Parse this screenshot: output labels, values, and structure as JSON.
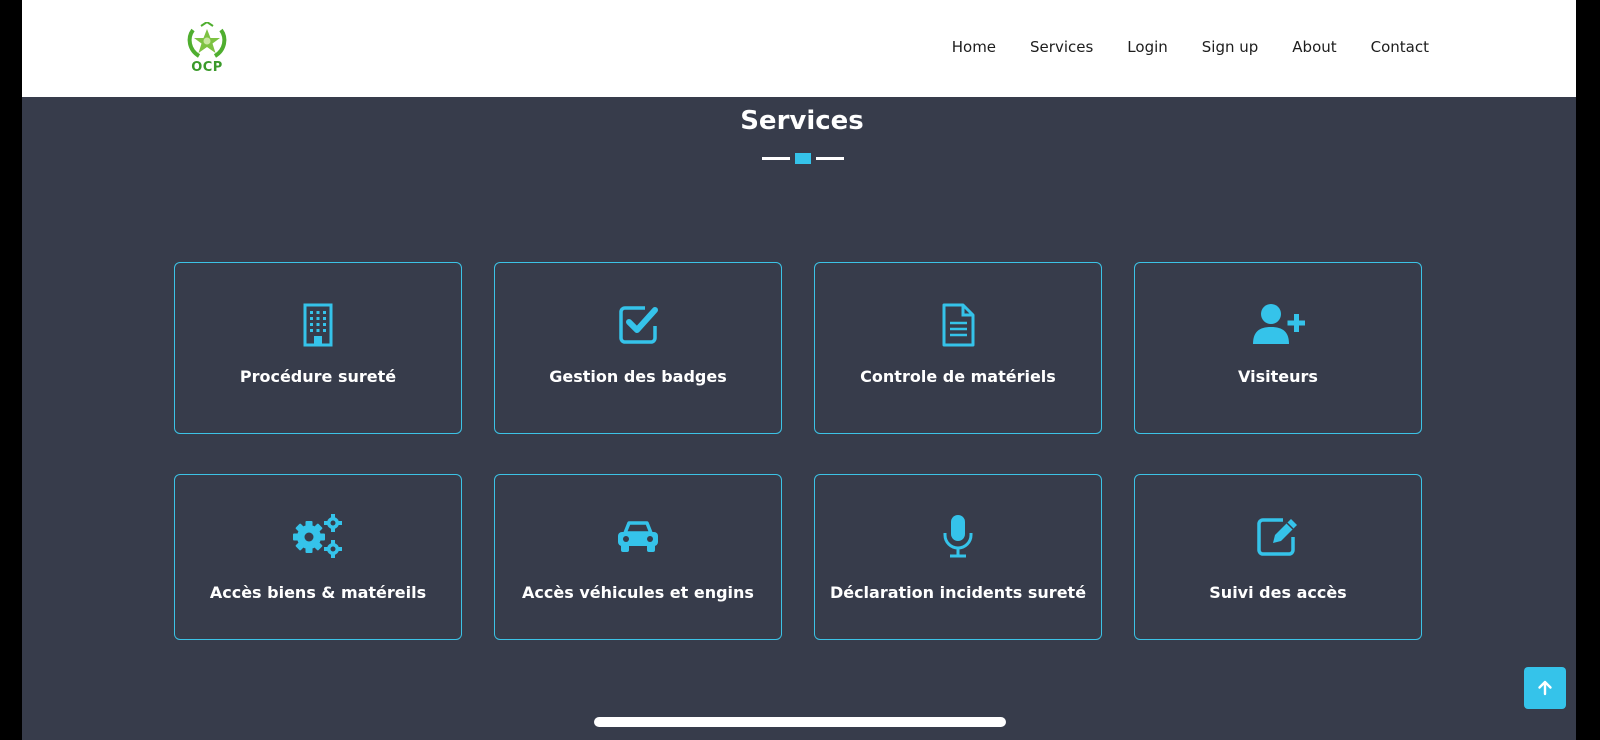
{
  "brand": {
    "logo_text": "OCP",
    "colors": {
      "accent": "#35c3ea",
      "background": "#373c4b",
      "logo_green": "#3a9a2a"
    }
  },
  "nav": {
    "links": [
      "Home",
      "Services",
      "Login",
      "Sign up",
      "About",
      "Contact"
    ]
  },
  "main": {
    "title": "Services",
    "services": [
      {
        "label": "Procédure sureté",
        "icon": "building-icon"
      },
      {
        "label": "Gestion des badges",
        "icon": "check-square-icon"
      },
      {
        "label": "Controle de matériels",
        "icon": "document-icon"
      },
      {
        "label": "Visiteurs",
        "icon": "user-plus-icon"
      },
      {
        "label": "Accès biens & matéreils",
        "icon": "cogs-icon"
      },
      {
        "label": "Accès véhicules et engins",
        "icon": "car-icon"
      },
      {
        "label": "Déclaration incidents sureté",
        "icon": "microphone-icon"
      },
      {
        "label": "Suivi des accès",
        "icon": "edit-icon"
      }
    ]
  },
  "back_to_top": {
    "icon": "arrow-up-icon"
  }
}
